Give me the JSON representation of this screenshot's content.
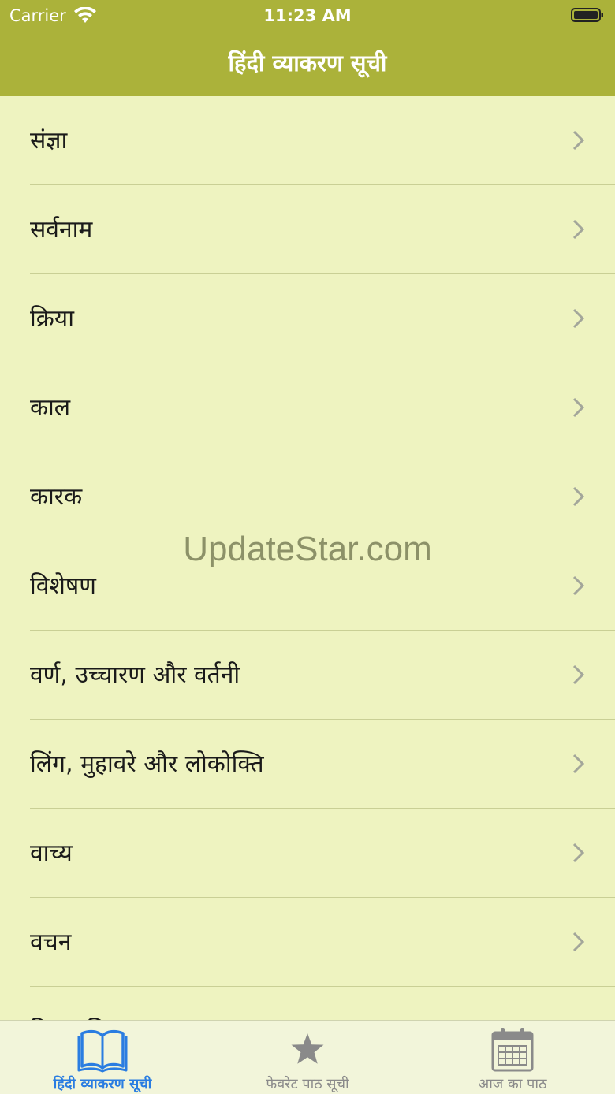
{
  "status_bar": {
    "carrier": "Carrier",
    "time": "11:23 AM"
  },
  "nav": {
    "title": "हिंदी व्याकरण सूची"
  },
  "list": {
    "items": [
      {
        "label": "संज्ञा"
      },
      {
        "label": "सर्वनाम"
      },
      {
        "label": "क्रिया"
      },
      {
        "label": "काल"
      },
      {
        "label": "कारक"
      },
      {
        "label": "विशेषण"
      },
      {
        "label": "वर्ण, उच्चारण और वर्तनी"
      },
      {
        "label": "लिंग, मुहावरे और लोकोक्ति"
      },
      {
        "label": "वाच्य"
      },
      {
        "label": "वचन"
      },
      {
        "label": "विराम चिह्न"
      }
    ]
  },
  "watermark": "UpdateStar.com",
  "tab_bar": {
    "tabs": [
      {
        "label": "हिंदी व्याकरण सूची",
        "icon": "book-icon",
        "active": true
      },
      {
        "label": "फेवरेट पाठ सूची",
        "icon": "star-icon",
        "active": false
      },
      {
        "label": "आज का पाठ",
        "icon": "calendar-icon",
        "active": false
      }
    ]
  },
  "colors": {
    "bar": "#abb23a",
    "background": "#eef3c0",
    "active_tab": "#2a7de1"
  }
}
